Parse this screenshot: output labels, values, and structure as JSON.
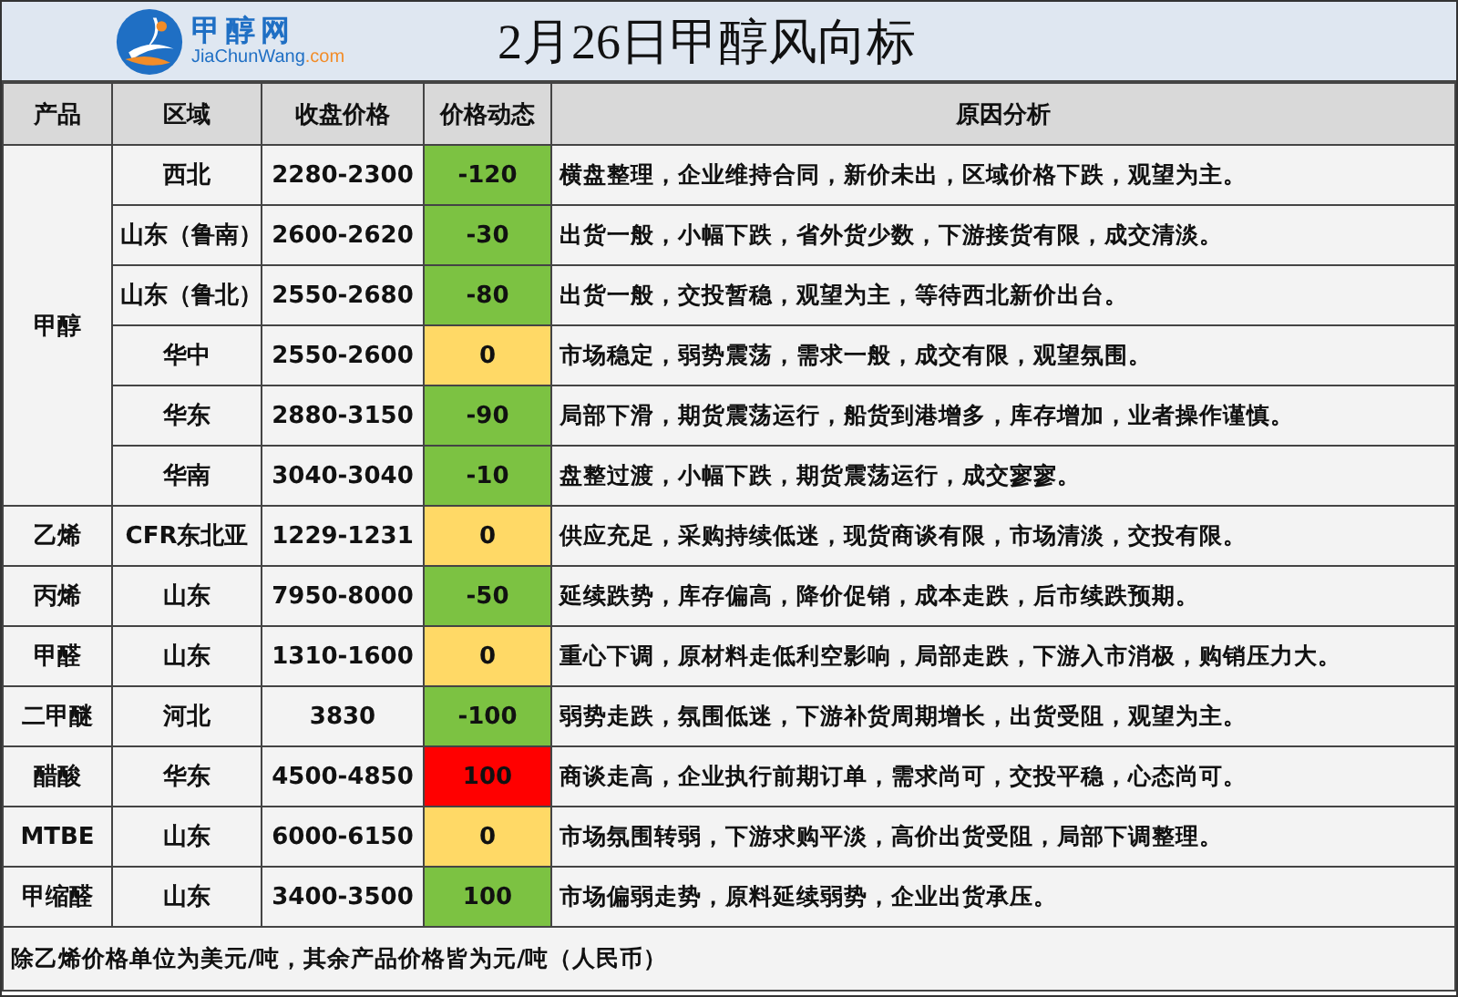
{
  "header": {
    "logo_name": "甲醇网",
    "logo_domain": "JiaChunWang",
    "logo_suffix": ".com",
    "title": "2月26日甲醇风向标"
  },
  "table": {
    "columns": [
      "产品",
      "区域",
      "收盘价格",
      "价格动态",
      "原因分析"
    ],
    "groups": [
      {
        "product": "甲醇",
        "rows": [
          {
            "region": "西北",
            "price": "2280-2300",
            "change": "-120",
            "color": "#7cc242",
            "analysis": "横盘整理，企业维持合同，新价未出，区域价格下跌，观望为主。"
          },
          {
            "region": "山东（鲁南）",
            "price": "2600-2620",
            "change": "-30",
            "color": "#7cc242",
            "analysis": "出货一般，小幅下跌，省外货少数，下游接货有限，成交清淡。"
          },
          {
            "region": "山东（鲁北）",
            "price": "2550-2680",
            "change": "-80",
            "color": "#7cc242",
            "analysis": "出货一般，交投暂稳，观望为主，等待西北新价出台。"
          },
          {
            "region": "华中",
            "price": "2550-2600",
            "change": "0",
            "color": "#ffd966",
            "analysis": "市场稳定，弱势震荡，需求一般，成交有限，观望氛围。"
          },
          {
            "region": "华东",
            "price": "2880-3150",
            "change": "-90",
            "color": "#7cc242",
            "analysis": "局部下滑，期货震荡运行，船货到港增多，库存增加，业者操作谨慎。"
          },
          {
            "region": "华南",
            "price": "3040-3040",
            "change": "-10",
            "color": "#7cc242",
            "analysis": "盘整过渡，小幅下跌，期货震荡运行，成交寥寥。"
          }
        ]
      },
      {
        "product": "乙烯",
        "rows": [
          {
            "region": "CFR东北亚",
            "price": "1229-1231",
            "change": "0",
            "color": "#ffd966",
            "analysis": "供应充足，采购持续低迷，现货商谈有限，市场清淡，交投有限。"
          }
        ]
      },
      {
        "product": "丙烯",
        "rows": [
          {
            "region": "山东",
            "price": "7950-8000",
            "change": "-50",
            "color": "#7cc242",
            "analysis": "延续跌势，库存偏高，降价促销，成本走跌，后市续跌预期。"
          }
        ]
      },
      {
        "product": "甲醛",
        "rows": [
          {
            "region": "山东",
            "price": "1310-1600",
            "change": "0",
            "color": "#ffd966",
            "analysis": "重心下调，原材料走低利空影响，局部走跌，下游入市消极，购销压力大。"
          }
        ]
      },
      {
        "product": "二甲醚",
        "rows": [
          {
            "region": "河北",
            "price": "3830",
            "change": "-100",
            "color": "#7cc242",
            "analysis": "弱势走跌，氛围低迷，下游补货周期增长，出货受阻，观望为主。"
          }
        ]
      },
      {
        "product": "醋酸",
        "rows": [
          {
            "region": "华东",
            "price": "4500-4850",
            "change": "100",
            "color": "#ff0000",
            "analysis": "商谈走高，企业执行前期订单，需求尚可，交投平稳，心态尚可。"
          }
        ]
      },
      {
        "product": "MTBE",
        "rows": [
          {
            "region": "山东",
            "price": "6000-6150",
            "change": "0",
            "color": "#ffd966",
            "analysis": "市场氛围转弱，下游求购平淡，高价出货受阻，局部下调整理。"
          }
        ]
      },
      {
        "product": "甲缩醛",
        "rows": [
          {
            "region": "山东",
            "price": "3400-3500",
            "change": "100",
            "color": "#7cc242",
            "analysis": "市场偏弱走势，原料延续弱势，企业出货承压。"
          }
        ]
      }
    ]
  },
  "footnote": "除乙烯价格单位为美元/吨，其余产品价格皆为元/吨（人民币）"
}
